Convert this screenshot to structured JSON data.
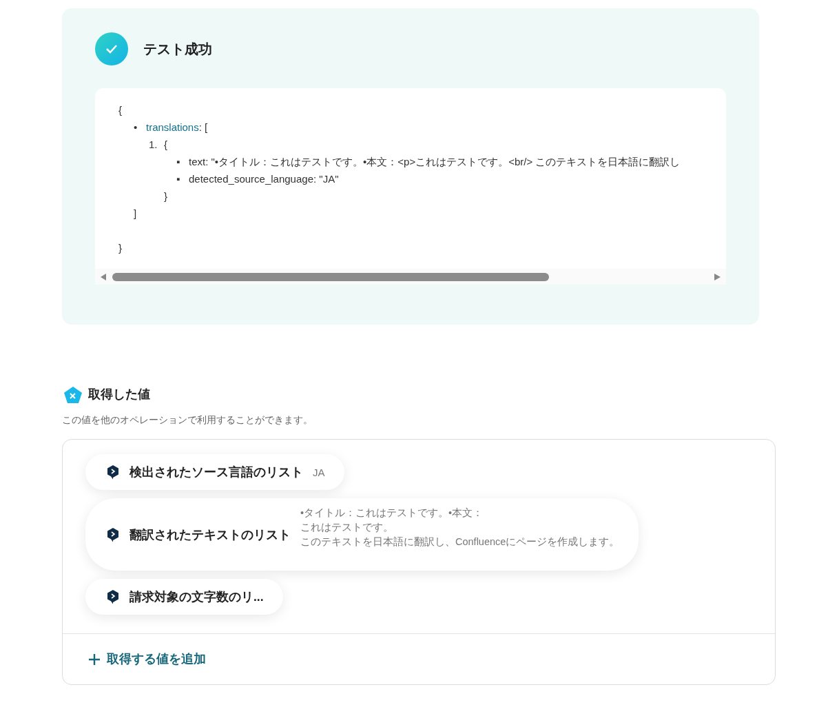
{
  "test_result": {
    "title": "テスト成功",
    "code": {
      "open": "{",
      "close": "}",
      "items": [
        {
          "marker": "•",
          "key": "translations",
          "text": ": [",
          "close": "]",
          "children": [
            {
              "marker": "1.",
              "text": "{",
              "close": "}",
              "children": [
                {
                  "marker": "▪",
                  "text": "text: \"•タイトル：これはテストです。•本文：<p>これはテストです。<br/> このテキストを日本語に翻訳し"
                },
                {
                  "marker": "▪",
                  "text": "detected_source_language: \"JA\""
                }
              ]
            }
          ]
        }
      ]
    }
  },
  "values_section": {
    "title": "取得した値",
    "description": "この値を他のオペレーションで利用することができます。",
    "items": [
      {
        "label": "検出されたソース言語のリスト",
        "value_lines": [
          "JA"
        ]
      },
      {
        "label": "翻訳されたテキストのリスト",
        "value_lines": [
          "•タイトル：これはテストです。•本文：",
          "これはテストです。",
          "このテキストを日本語に翻訳し、Confluenceにページを作成します。"
        ]
      },
      {
        "label": "請求対象の文字数のリ..."
      }
    ],
    "add_button": "取得する値を追加"
  }
}
